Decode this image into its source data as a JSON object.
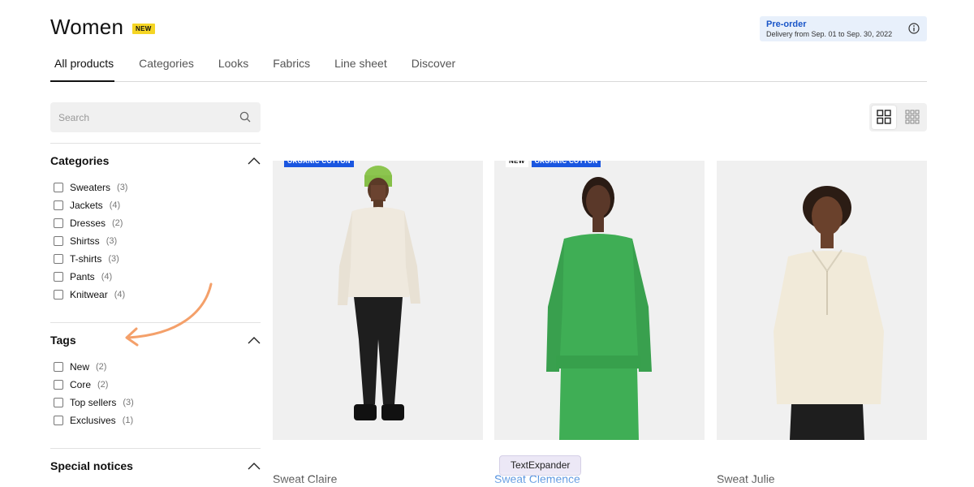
{
  "header": {
    "title": "Women",
    "badge": "NEW",
    "preorder": {
      "title": "Pre-order",
      "subtitle": "Delivery from Sep. 01 to Sep. 30, 2022",
      "icon": "info-icon"
    }
  },
  "tabs": [
    {
      "label": "All products",
      "active": true
    },
    {
      "label": "Categories",
      "active": false
    },
    {
      "label": "Looks",
      "active": false
    },
    {
      "label": "Fabrics",
      "active": false
    },
    {
      "label": "Line sheet",
      "active": false
    },
    {
      "label": "Discover",
      "active": false
    }
  ],
  "search": {
    "placeholder": "Search",
    "value": "",
    "icon": "search-icon"
  },
  "filters": {
    "categories": {
      "title": "Categories",
      "items": [
        {
          "label": "Sweaters",
          "count": "(3)"
        },
        {
          "label": "Jackets",
          "count": "(4)"
        },
        {
          "label": "Dresses",
          "count": "(2)"
        },
        {
          "label": "Shirtss",
          "count": "(3)"
        },
        {
          "label": "T-shirts",
          "count": "(3)"
        },
        {
          "label": "Pants",
          "count": "(4)"
        },
        {
          "label": "Knitwear",
          "count": "(4)"
        }
      ]
    },
    "tags": {
      "title": "Tags",
      "items": [
        {
          "label": "New",
          "count": "(2)"
        },
        {
          "label": "Core",
          "count": "(2)"
        },
        {
          "label": "Top sellers",
          "count": "(3)"
        },
        {
          "label": "Exclusives",
          "count": "(1)"
        }
      ]
    },
    "special": {
      "title": "Special notices"
    }
  },
  "view_toggle": {
    "active": "grid-large",
    "options": [
      "grid-large-icon",
      "grid-small-icon"
    ]
  },
  "products": [
    {
      "name": "Sweat Claire",
      "tags": [
        "ORGANIC COTTON"
      ],
      "color": "#efe9de",
      "pants": "#1e1e1e"
    },
    {
      "name": "Sweat Clemence",
      "tags": [
        "NEW",
        "ORGANIC COTTON"
      ],
      "color": "#3fae55",
      "pants": "#3fae55"
    },
    {
      "name": "Sweat Julie",
      "tags": [],
      "color": "#f1ead9",
      "pants": "#1e1e1e"
    }
  ],
  "overlay": {
    "textexpander": "TextExpander"
  },
  "colors": {
    "accent": "#1a56e0",
    "badge": "#f5d524",
    "arrow": "#f4a06a",
    "link": "#1a6dd4"
  }
}
